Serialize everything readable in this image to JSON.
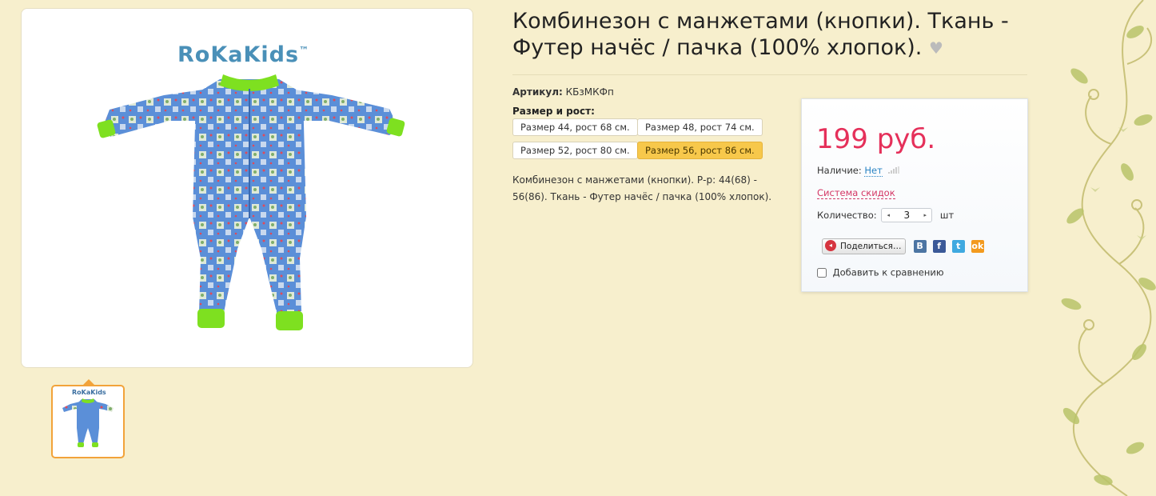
{
  "product": {
    "title": "Комбинезон с манжетами (кнопки). Ткань - Футер начёс / пачка (100% хлопок).",
    "brand": "RoKaKids",
    "brand_mark": "™",
    "sku_label": "Артикул:",
    "sku_value": "КБзМКФп",
    "size_label": "Размер и рост:",
    "sizes": [
      {
        "label": "Размер 44, рост 68 см.",
        "active": false
      },
      {
        "label": "Размер 48, рост 74 см.",
        "active": false
      },
      {
        "label": "Размер 52, рост 80 см.",
        "active": false
      },
      {
        "label": "Размер 56, рост 86 см.",
        "active": true
      }
    ],
    "description": "Комбинезон с манжетами (кнопки). Р-р: 44(68) - 56(86). Ткань - Футер начёс / пачка (100% хлопок)."
  },
  "buy": {
    "price": "199 руб.",
    "availability_label": "Наличие:",
    "availability_value": "Нет",
    "discount_link": "Система скидок",
    "quantity_label": "Количество:",
    "quantity_value": "3",
    "quantity_unit": "шт",
    "share_label": "Поделиться…",
    "social": [
      "В",
      "f",
      "t",
      "ok"
    ],
    "compare_label": "Добавить к сравнению"
  },
  "colors": {
    "background": "#f7efcd",
    "price": "#e5305a",
    "accent": "#f7c84b",
    "link": "#2a84c4"
  },
  "icons": [
    "heart-icon",
    "signal-icon",
    "speaker-icon",
    "vk-icon",
    "facebook-icon",
    "twitter-icon",
    "odnoklassniki-icon"
  ]
}
